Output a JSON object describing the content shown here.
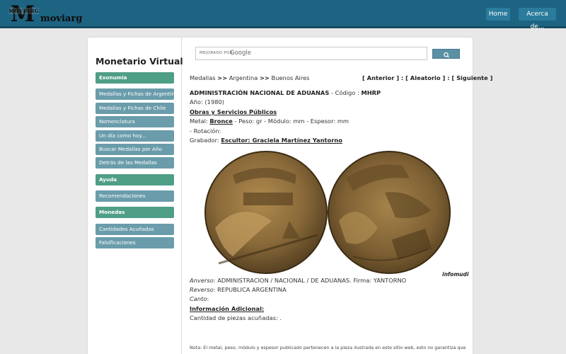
{
  "header": {
    "logo_small": "MOVIARG",
    "logo_letter": "M",
    "logo_word": "moviarg",
    "nav": {
      "home": "Home",
      "about": "Acerca de..."
    }
  },
  "sidebar": {
    "title": "Monetario Virtual",
    "items": [
      {
        "label": "Exonumia"
      },
      {
        "label": "Medallas y Fichas de Argentina"
      },
      {
        "label": "Medallas y Fichas de Chile"
      },
      {
        "label": "Nomenclatura"
      },
      {
        "label": "Un día como hoy..."
      },
      {
        "label": "Buscar Medallas por Año"
      },
      {
        "label": "Detrás de las Medallas"
      },
      {
        "label": "Ayuda"
      },
      {
        "label": "Recomendaciones"
      },
      {
        "label": "Monedas"
      },
      {
        "label": "Cantidades Acuñadas"
      },
      {
        "label": "Falsificaciones"
      }
    ]
  },
  "search": {
    "label": "MEJORADO POR",
    "brand": "Google"
  },
  "breadcrumb": {
    "a": "Medallas",
    "sep1": ">>",
    "b": "Argentina",
    "sep2": ">>",
    "c": "Buenos Aires"
  },
  "pager": {
    "prev": "[ Anterior ]",
    "sep1": ":",
    "random": "[ Aleatorio ]",
    "sep2": ":",
    "next": "[ Siguiente ]"
  },
  "medal": {
    "name": "ADMINISTRACIÓN NACIONAL DE ADUANAS",
    "code_label": "- Código :",
    "code": "MHRP",
    "year": "Año: (1980)",
    "category": "Obras y Servicios Públicos",
    "metal_label": "Metal:",
    "metal": "Bronce",
    "specs": "- Peso: gr - Módulo: mm - Espesor: mm",
    "rotation": "- Rotación:",
    "engraver_label": "Grabador:",
    "engraver": "Escultor: Graciela Martínez Yantorno",
    "credit": "infomudi",
    "obverse_label": "Anverso",
    "obverse": ": ADMINISTRACION / NACIONAL / DE ADUANAS. Firma: YANTORNO",
    "reverse_label": "Reverso",
    "reverse": ": REPUBLICA ARGENTINA",
    "edge_label": "Canto",
    "edge": ":",
    "extra_title": "Información Adicional:",
    "quantity": "Cantidad de piezas acuñadas: .",
    "note": "Nota: El metal, peso, módulo y espesor publicado pertenecen a la pieza ilustrada en este sitio web, esto no garantiza que"
  },
  "colors": {
    "header": "#1d6382",
    "sidebar_gray": "#6a9cab",
    "sidebar_green": "#4f9e86",
    "bronze": "#8a6a3a"
  }
}
